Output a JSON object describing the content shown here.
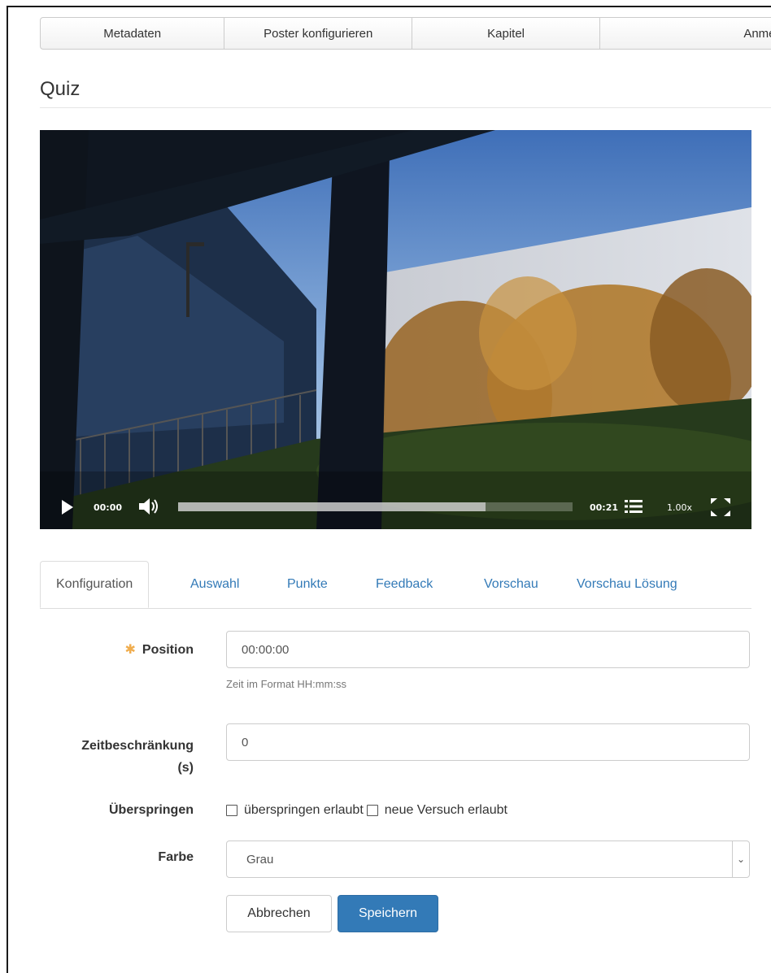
{
  "topnav": {
    "tabs": [
      {
        "label": "Metadaten"
      },
      {
        "label": "Poster konfigurieren"
      },
      {
        "label": "Kapitel"
      },
      {
        "label": "Anmerk"
      }
    ]
  },
  "page": {
    "title": "Quiz"
  },
  "player": {
    "current_time": "00:00",
    "duration": "00:21",
    "playback_rate": "1.00x",
    "progress_buffered_percent": 78
  },
  "tabs": [
    {
      "label": "Konfiguration",
      "active": true
    },
    {
      "label": "Auswahl"
    },
    {
      "label": "Punkte"
    },
    {
      "label": "Feedback"
    },
    {
      "label": "Vorschau"
    },
    {
      "label": "Vorschau Lösung"
    }
  ],
  "form": {
    "position": {
      "label": "Position",
      "value": "00:00:00",
      "help": "Zeit im Format HH:mm:ss",
      "required_mark": "✱"
    },
    "time_limit": {
      "label_line1": "Zeitbeschränkung",
      "label_line2": "(s)",
      "value": "0"
    },
    "skip": {
      "label": "Überspringen",
      "option1": "überspringen erlaubt",
      "option2": "neue Versuch erlaubt"
    },
    "color": {
      "label": "Farbe",
      "value": "Grau"
    },
    "cancel_label": "Abbrechen",
    "save_label": "Speichern"
  },
  "colors": {
    "primary": "#337ab7",
    "required": "#f0ad4e",
    "link": "#337ab7"
  },
  "icons": [
    "play-icon",
    "volume-icon",
    "chapters-list-icon",
    "fullscreen-icon",
    "required-asterisk-icon",
    "chevron-down-icon"
  ]
}
